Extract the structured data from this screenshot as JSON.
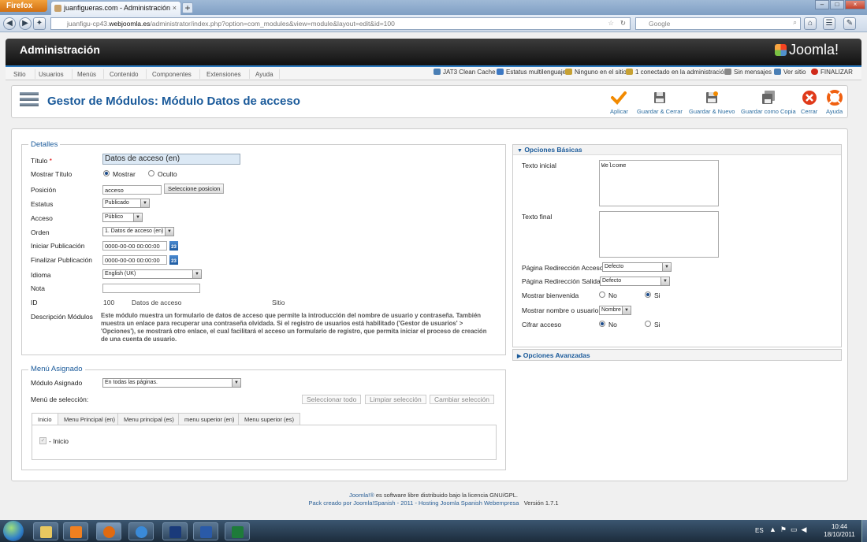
{
  "browser": {
    "firefox_button": "Firefox",
    "tab_title": "juanfigueras.com - Administración",
    "new_tab": "+",
    "url_prefix": "juanfigu-cp43.",
    "url_domain": "webjoomla.es",
    "url_rest": "/administrator/index.php?option=com_modules&view=module&layout=edit&id=100",
    "search_placeholder": "Google"
  },
  "header": {
    "title": "Administración",
    "logo_text": "Joomla!"
  },
  "menu": {
    "items": [
      "Sitio",
      "Usuarios",
      "Menús",
      "Contenido",
      "Componentes",
      "Extensiones",
      "Ayuda"
    ],
    "status": [
      {
        "label": "JAT3 Clean Cache",
        "color": "#4a7fb5"
      },
      {
        "label": "Estatus multilenguaje",
        "color": "#3c78c3"
      },
      {
        "label": "Ninguno en el sitio",
        "color": "#c7a133"
      },
      {
        "label": "1 conectado en la administración",
        "color": "#c7a133"
      },
      {
        "label": "Sin mensajes",
        "color": "#888888"
      },
      {
        "label": "Ver sitio",
        "color": "#4a7fb5"
      },
      {
        "label": "FINALIZAR",
        "color": "#d02a1a"
      }
    ]
  },
  "toolbar": {
    "page_title": "Gestor de Módulos: Módulo Datos de acceso",
    "buttons": [
      {
        "label": "Aplicar",
        "icon": "check-icon",
        "color": "#f28a00"
      },
      {
        "label": "Guardar & Cerrar",
        "icon": "save-icon",
        "color": "#555555"
      },
      {
        "label": "Guardar & Nuevo",
        "icon": "save-new-icon",
        "color": "#555555"
      },
      {
        "label": "Guardar como Copia",
        "icon": "save-copy-icon",
        "color": "#555555"
      },
      {
        "label": "Cerrar",
        "icon": "close-icon",
        "color": "#e03a1a"
      },
      {
        "label": "Ayuda",
        "icon": "help-icon",
        "color": "#f06010"
      }
    ]
  },
  "details": {
    "legend": "Detalles",
    "titulo_label": "Título",
    "required_mark": "*",
    "titulo_value": "Datos de acceso (en)",
    "mostrar_titulo_label": "Mostrar Título",
    "mostrar_option": "Mostrar",
    "oculto_option": "Oculto",
    "posicion_label": "Posición",
    "posicion_value": "acceso",
    "posicion_button": "Seleccione posicion",
    "estatus_label": "Estatus",
    "estatus_value": "Publicado",
    "acceso_label": "Acceso",
    "acceso_value": "Público",
    "orden_label": "Orden",
    "orden_value": "1. Datos de acceso (en)",
    "iniciar_label": "Iniciar Publicación",
    "iniciar_value": "0000-00-00 00:00:00",
    "finalizar_label": "Finalizar Publicación",
    "finalizar_value": "0000-00-00 00:00:00",
    "calendar_text": "23",
    "idioma_label": "Idioma",
    "idioma_value": "English (UK)",
    "nota_label": "Nota",
    "nota_value": "",
    "id_label": "ID",
    "id_value": "100",
    "id_name": "Datos de acceso",
    "id_site": "Sitio",
    "desc_label": "Descripción Módulos",
    "desc_text": "Este módulo muestra un formulario de datos de acceso que permite la introducción del nombre de usuario y contraseña. También muestra un enlace para recuperar una contraseña olvidada. Si el registro de usuarios está habilitado ('Gestor de usuarios' > 'Opciones'), se mostrará otro enlace, el cual facilitará el acceso un formulario de registro, que permita iniciar el proceso de creación de una cuenta de usuario."
  },
  "assigned_menu": {
    "legend": "Menú Asignado",
    "modulo_label": "Módulo Asignado",
    "modulo_value": "En todas las páginas.",
    "seleccion_label": "Menú de selección:",
    "btn_select_all": "Seleccionar todo",
    "btn_clear": "Limpiar selección",
    "btn_toggle": "Cambiar selección",
    "tabs": [
      "Inicio",
      "Menu Principal (en)",
      "Menu principal (es)",
      "menu superior (en)",
      "Menu superior (es)"
    ],
    "item_label": "- Inicio"
  },
  "basic_options": {
    "header": "Opciones Básicas",
    "texto_inicial_label": "Texto inicial",
    "texto_inicial_value": "Welcome",
    "texto_final_label": "Texto final",
    "texto_final_value": "",
    "redir_acceso_label": "Página Redirección Acceso",
    "redir_acceso_value": "Defecto",
    "redir_salida_label": "Página Redirección Salida",
    "redir_salida_value": "Defecto",
    "bienvenida_label": "Mostrar bienvenida",
    "bienvenida_no": "No",
    "bienvenida_si": "Si",
    "nombre_label": "Mostrar nombre o usuario",
    "nombre_value": "Nombre",
    "cifrar_label": "Cifrar acceso",
    "cifrar_no": "No",
    "cifrar_si": "Si"
  },
  "advanced_options": {
    "header": "Opciones Avanzadas"
  },
  "footer": {
    "line1_link": "Joomla!®",
    "line1_text": "es software libre distribuido bajo la licencia GNU/GPL.",
    "line2_link": "Pack creado por Joomla!Spanish - 2011 - Hosting Joomla Spanish Webempresa",
    "line2_version": "Versión 1.7.1"
  },
  "taskbar": {
    "lang": "ES",
    "time": "10:44",
    "date": "18/10/2011",
    "apps": [
      {
        "icon": "folder-icon",
        "color": "#e8c860"
      },
      {
        "icon": "media-player-icon",
        "color": "#f08020"
      },
      {
        "icon": "firefox-icon",
        "color": "#e06a10"
      },
      {
        "icon": "ie-icon",
        "color": "#3a8ad8"
      },
      {
        "icon": "photoshop-icon",
        "color": "#1a3a7a"
      },
      {
        "icon": "network-icon",
        "color": "#2a5aa8"
      },
      {
        "icon": "excel-icon",
        "color": "#1e7b3a"
      }
    ]
  }
}
